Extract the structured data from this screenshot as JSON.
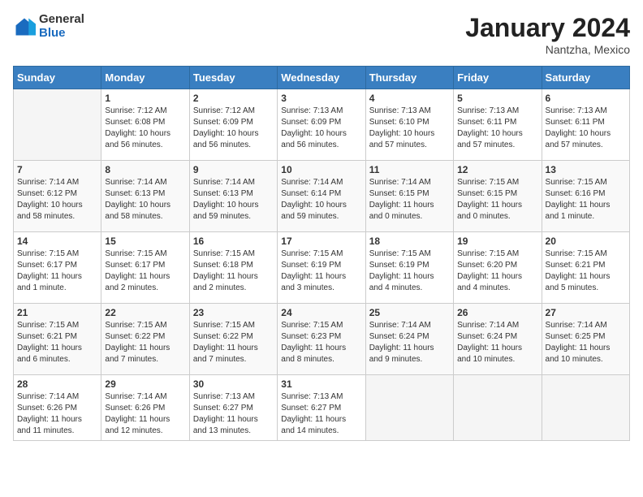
{
  "header": {
    "logo": {
      "line1": "General",
      "line2": "Blue"
    },
    "title": "January 2024",
    "location": "Nantzha, Mexico"
  },
  "weekdays": [
    "Sunday",
    "Monday",
    "Tuesday",
    "Wednesday",
    "Thursday",
    "Friday",
    "Saturday"
  ],
  "weeks": [
    [
      {
        "day": "",
        "info": ""
      },
      {
        "day": "1",
        "info": "Sunrise: 7:12 AM\nSunset: 6:08 PM\nDaylight: 10 hours\nand 56 minutes."
      },
      {
        "day": "2",
        "info": "Sunrise: 7:12 AM\nSunset: 6:09 PM\nDaylight: 10 hours\nand 56 minutes."
      },
      {
        "day": "3",
        "info": "Sunrise: 7:13 AM\nSunset: 6:09 PM\nDaylight: 10 hours\nand 56 minutes."
      },
      {
        "day": "4",
        "info": "Sunrise: 7:13 AM\nSunset: 6:10 PM\nDaylight: 10 hours\nand 57 minutes."
      },
      {
        "day": "5",
        "info": "Sunrise: 7:13 AM\nSunset: 6:11 PM\nDaylight: 10 hours\nand 57 minutes."
      },
      {
        "day": "6",
        "info": "Sunrise: 7:13 AM\nSunset: 6:11 PM\nDaylight: 10 hours\nand 57 minutes."
      }
    ],
    [
      {
        "day": "7",
        "info": "Sunrise: 7:14 AM\nSunset: 6:12 PM\nDaylight: 10 hours\nand 58 minutes."
      },
      {
        "day": "8",
        "info": "Sunrise: 7:14 AM\nSunset: 6:13 PM\nDaylight: 10 hours\nand 58 minutes."
      },
      {
        "day": "9",
        "info": "Sunrise: 7:14 AM\nSunset: 6:13 PM\nDaylight: 10 hours\nand 59 minutes."
      },
      {
        "day": "10",
        "info": "Sunrise: 7:14 AM\nSunset: 6:14 PM\nDaylight: 10 hours\nand 59 minutes."
      },
      {
        "day": "11",
        "info": "Sunrise: 7:14 AM\nSunset: 6:15 PM\nDaylight: 11 hours\nand 0 minutes."
      },
      {
        "day": "12",
        "info": "Sunrise: 7:15 AM\nSunset: 6:15 PM\nDaylight: 11 hours\nand 0 minutes."
      },
      {
        "day": "13",
        "info": "Sunrise: 7:15 AM\nSunset: 6:16 PM\nDaylight: 11 hours\nand 1 minute."
      }
    ],
    [
      {
        "day": "14",
        "info": "Sunrise: 7:15 AM\nSunset: 6:17 PM\nDaylight: 11 hours\nand 1 minute."
      },
      {
        "day": "15",
        "info": "Sunrise: 7:15 AM\nSunset: 6:17 PM\nDaylight: 11 hours\nand 2 minutes."
      },
      {
        "day": "16",
        "info": "Sunrise: 7:15 AM\nSunset: 6:18 PM\nDaylight: 11 hours\nand 2 minutes."
      },
      {
        "day": "17",
        "info": "Sunrise: 7:15 AM\nSunset: 6:19 PM\nDaylight: 11 hours\nand 3 minutes."
      },
      {
        "day": "18",
        "info": "Sunrise: 7:15 AM\nSunset: 6:19 PM\nDaylight: 11 hours\nand 4 minutes."
      },
      {
        "day": "19",
        "info": "Sunrise: 7:15 AM\nSunset: 6:20 PM\nDaylight: 11 hours\nand 4 minutes."
      },
      {
        "day": "20",
        "info": "Sunrise: 7:15 AM\nSunset: 6:21 PM\nDaylight: 11 hours\nand 5 minutes."
      }
    ],
    [
      {
        "day": "21",
        "info": "Sunrise: 7:15 AM\nSunset: 6:21 PM\nDaylight: 11 hours\nand 6 minutes."
      },
      {
        "day": "22",
        "info": "Sunrise: 7:15 AM\nSunset: 6:22 PM\nDaylight: 11 hours\nand 7 minutes."
      },
      {
        "day": "23",
        "info": "Sunrise: 7:15 AM\nSunset: 6:22 PM\nDaylight: 11 hours\nand 7 minutes."
      },
      {
        "day": "24",
        "info": "Sunrise: 7:15 AM\nSunset: 6:23 PM\nDaylight: 11 hours\nand 8 minutes."
      },
      {
        "day": "25",
        "info": "Sunrise: 7:14 AM\nSunset: 6:24 PM\nDaylight: 11 hours\nand 9 minutes."
      },
      {
        "day": "26",
        "info": "Sunrise: 7:14 AM\nSunset: 6:24 PM\nDaylight: 11 hours\nand 10 minutes."
      },
      {
        "day": "27",
        "info": "Sunrise: 7:14 AM\nSunset: 6:25 PM\nDaylight: 11 hours\nand 10 minutes."
      }
    ],
    [
      {
        "day": "28",
        "info": "Sunrise: 7:14 AM\nSunset: 6:26 PM\nDaylight: 11 hours\nand 11 minutes."
      },
      {
        "day": "29",
        "info": "Sunrise: 7:14 AM\nSunset: 6:26 PM\nDaylight: 11 hours\nand 12 minutes."
      },
      {
        "day": "30",
        "info": "Sunrise: 7:13 AM\nSunset: 6:27 PM\nDaylight: 11 hours\nand 13 minutes."
      },
      {
        "day": "31",
        "info": "Sunrise: 7:13 AM\nSunset: 6:27 PM\nDaylight: 11 hours\nand 14 minutes."
      },
      {
        "day": "",
        "info": ""
      },
      {
        "day": "",
        "info": ""
      },
      {
        "day": "",
        "info": ""
      }
    ]
  ]
}
